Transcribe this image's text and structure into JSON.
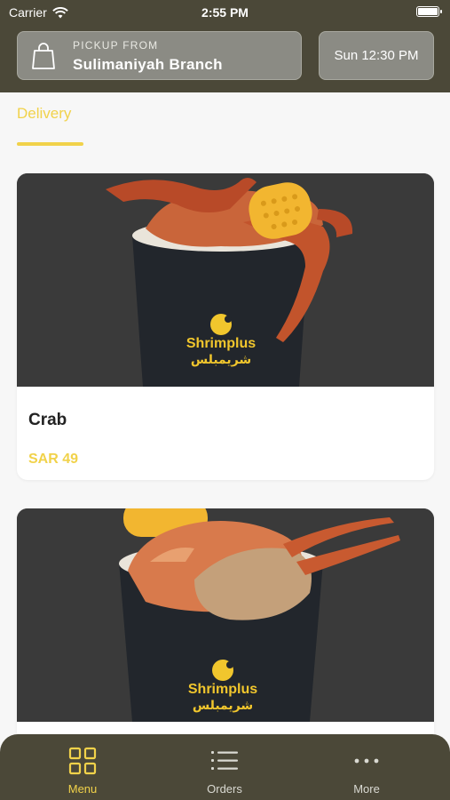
{
  "status_bar": {
    "carrier": "Carrier",
    "time": "2:55 PM"
  },
  "pickup": {
    "label": "PICKUP FROM",
    "branch": "Sulimaniyah Branch",
    "icon": "shopping-bag-icon"
  },
  "schedule": {
    "label": "Sun 12:30 PM"
  },
  "tabs": {
    "delivery": "Delivery"
  },
  "items": [
    {
      "name": "Crab",
      "price": "SAR 49",
      "brand_en": "Shrimplus",
      "brand_ar": "شريمبلس"
    },
    {
      "name": "",
      "price": "",
      "brand_en": "Shrimplus",
      "brand_ar": "شريمبلس"
    }
  ],
  "bottom_nav": [
    {
      "label": "Menu",
      "icon": "grid-icon",
      "active": true
    },
    {
      "label": "Orders",
      "icon": "list-icon",
      "active": false
    },
    {
      "label": "More",
      "icon": "more-icon",
      "active": false
    }
  ],
  "colors": {
    "header": "#4b4838",
    "accent": "#f1d24a",
    "background": "#f7f7f7"
  }
}
